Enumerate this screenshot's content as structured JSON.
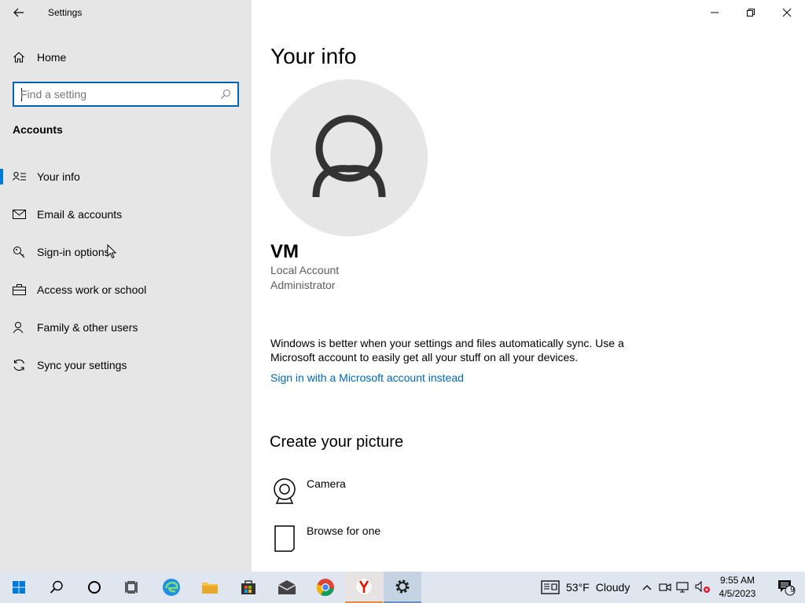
{
  "window": {
    "title": "Settings",
    "controls": {
      "minimize": "minimize",
      "restore": "restore",
      "close": "close"
    }
  },
  "sidebar": {
    "home_label": "Home",
    "search_placeholder": "Find a setting",
    "section_title": "Accounts",
    "items": [
      {
        "label": "Your info",
        "icon": "person-list-icon",
        "active": true
      },
      {
        "label": "Email & accounts",
        "icon": "mail-icon",
        "active": false
      },
      {
        "label": "Sign-in options",
        "icon": "key-icon",
        "active": false
      },
      {
        "label": "Access work or school",
        "icon": "briefcase-icon",
        "active": false
      },
      {
        "label": "Family & other users",
        "icon": "person-add-icon",
        "active": false
      },
      {
        "label": "Sync your settings",
        "icon": "sync-icon",
        "active": false
      }
    ]
  },
  "main": {
    "title": "Your info",
    "user": {
      "name": "VM",
      "account_type": "Local Account",
      "role": "Administrator"
    },
    "sync_message": "Windows is better when your settings and files automatically sync. Use a Microsoft account to easily get all your stuff on all your devices.",
    "ms_link": "Sign in with a Microsoft account instead",
    "create_picture": {
      "title": "Create your picture",
      "options": [
        {
          "label": "Camera",
          "icon": "camera-icon"
        },
        {
          "label": "Browse for one",
          "icon": "file-icon"
        }
      ]
    }
  },
  "taskbar": {
    "weather": {
      "temp": "53°F",
      "condition": "Cloudy"
    },
    "clock": {
      "time": "9:55 AM",
      "date": "4/5/2023"
    },
    "notification_count": "9",
    "accent": "#0078d7"
  }
}
